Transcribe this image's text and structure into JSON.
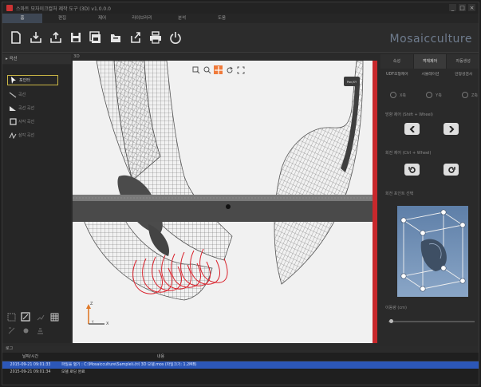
{
  "window": {
    "title": "스마트 모자이크컬처 제작 도구 (3D) v1.0.0.0",
    "controls": [
      "_",
      "□",
      "×"
    ]
  },
  "menubar": {
    "items": [
      {
        "label": "홈",
        "active": true
      },
      {
        "label": "편집",
        "active": false
      },
      {
        "label": "제어",
        "active": false
      },
      {
        "label": "라이브러리",
        "active": false
      },
      {
        "label": "분석",
        "active": false
      },
      {
        "label": "도움",
        "active": false
      }
    ]
  },
  "toolbar": {
    "buttons": [
      "new-file-icon",
      "import-icon",
      "export-icon",
      "save-icon",
      "save-as-icon",
      "open-folder-icon",
      "share-icon",
      "print-icon",
      "power-icon"
    ]
  },
  "brand": "Mosaicculture",
  "left_panel": {
    "header": "곡선",
    "tools": [
      {
        "label": "포인터",
        "icon": "pointer-icon",
        "selected": true
      },
      {
        "label": "곡선",
        "icon": "line-icon",
        "selected": false
      },
      {
        "label": "곡선 곡선",
        "icon": "triangle-icon",
        "selected": false
      },
      {
        "label": "사각 곡선",
        "icon": "square-icon",
        "selected": false
      },
      {
        "label": "삼각 곡선",
        "icon": "arc-icon",
        "selected": false
      }
    ]
  },
  "viewport": {
    "label": "3D",
    "tools": [
      "zoom-box-icon",
      "zoom-icon",
      "pan-icon",
      "rotate-icon",
      "fit-icon"
    ],
    "active_tool": "pan-icon",
    "axis": {
      "x": "X",
      "y": "Y",
      "z": "Z"
    },
    "handle_label": "Pan/XY"
  },
  "right_panel": {
    "tabs": [
      {
        "label": "속성",
        "active": false
      },
      {
        "label": "객체제어",
        "active": true
      },
      {
        "label": "자동생성",
        "active": false
      }
    ],
    "subtabs": [
      "UDF조형제어",
      "시뮬레이션",
      "안정성검사"
    ],
    "radios": [
      {
        "label": "X축",
        "checked": false
      },
      {
        "label": "Y축",
        "checked": false
      },
      {
        "label": "Z축",
        "checked": false
      }
    ],
    "move_label": "방향 제어 (Shift + Wheel)",
    "rotate_label": "회전 제어 (Ctrl + Wheel)",
    "view_label": "회전 포인트 선택",
    "scale_label": "이동량 (cm)"
  },
  "log": {
    "header": "로그",
    "columns": [
      "날짜/시간",
      "내용"
    ],
    "rows": [
      {
        "time": "2015-09-21 09:01:33",
        "text": "파일을 열기 : C:\\Mosaicculture\\Sample\\나비 3D 모델.mos (파일크기: 1.2MB)",
        "selected": true
      },
      {
        "time": "2015-09-21 09:01:34",
        "text": "모델 로딩 완료",
        "selected": false
      }
    ]
  },
  "colors": {
    "accent_orange": "#ef7a3a",
    "selection_yellow": "#c9b545",
    "log_selection_blue": "#2c57b8",
    "brand_blue_gray": "#6f7c8e",
    "mesh_red": "#d9202a"
  }
}
